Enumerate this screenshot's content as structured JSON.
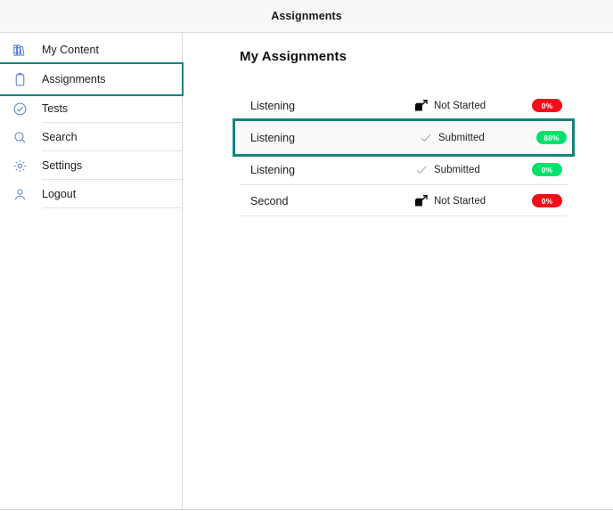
{
  "window": {
    "title": "Assignments"
  },
  "sidebar": {
    "items": [
      {
        "label": "My Content",
        "icon": "books-icon",
        "selected": false
      },
      {
        "label": "Assignments",
        "icon": "clipboard-icon",
        "selected": true
      },
      {
        "label": "Tests",
        "icon": "check-circle-icon",
        "selected": false
      },
      {
        "label": "Search",
        "icon": "search-icon",
        "selected": false
      },
      {
        "label": "Settings",
        "icon": "gear-icon",
        "selected": false
      },
      {
        "label": "Logout",
        "icon": "user-icon",
        "selected": false
      }
    ]
  },
  "main": {
    "page_title": "My Assignments",
    "assignments": [
      {
        "name": "Listening",
        "status": "Not Started",
        "status_icon": "launch-icon",
        "score": "0%",
        "score_color": "#f50d19",
        "highlighted": false
      },
      {
        "name": "Listening",
        "status": "Submitted",
        "status_icon": "check-icon",
        "score": "88%",
        "score_color": "#00e06b",
        "highlighted": true
      },
      {
        "name": "Listening",
        "status": "Submitted",
        "status_icon": "check-icon",
        "score": "0%",
        "score_color": "#00e06b",
        "highlighted": false
      },
      {
        "name": "Second",
        "status": "Not Started",
        "status_icon": "launch-icon",
        "score": "0%",
        "score_color": "#f50d19",
        "highlighted": false
      }
    ]
  },
  "colors": {
    "highlight_outline": "#13857a",
    "icon_blue": "#5b7fe0",
    "badge_red": "#f50d19",
    "badge_green": "#00e06b"
  }
}
